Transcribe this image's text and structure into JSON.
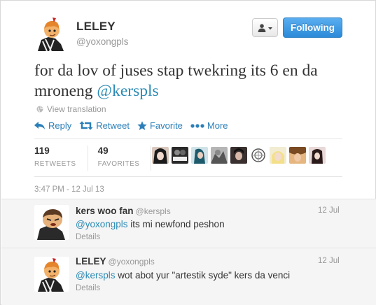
{
  "tweet": {
    "name": "LELEY",
    "handle": "@yoxongpls",
    "text_main": "for da lov of juses stap twekring its 6 en da mroneng ",
    "text_mention": "@kerspls",
    "view_translation": "View translation",
    "actions": {
      "reply": "Reply",
      "retweet": "Retweet",
      "favorite": "Favorite",
      "more": "More"
    },
    "stats": {
      "retweets_count": "119",
      "retweets_label": "RETWEETS",
      "favorites_count": "49",
      "favorites_label": "FAVORITES"
    },
    "timestamp": "3:47 PM - 12 Jul 13"
  },
  "header": {
    "follow_label": "Following",
    "follow_color": "#2b8ad9"
  },
  "favoriters": [
    "avatar-1",
    "avatar-2",
    "avatar-3",
    "avatar-4",
    "avatar-5",
    "avatar-6",
    "avatar-7",
    "avatar-8",
    "avatar-9"
  ],
  "replies": [
    {
      "name": "kers woo fan",
      "handle": "@kerspls",
      "time": "12 Jul",
      "mention": "@yoxongpls",
      "text": " its mi newfond peshon",
      "details": "Details"
    },
    {
      "name": "LELEY",
      "handle": "@yoxongpls",
      "time": "12 Jul",
      "mention": "@kerspls",
      "text": " wot abot yur \"artestik syde\" kers da venci",
      "details": "Details"
    }
  ],
  "colors": {
    "link": "#2a7fb8",
    "muted": "#999999",
    "reply_bg": "#f5f5f5"
  }
}
